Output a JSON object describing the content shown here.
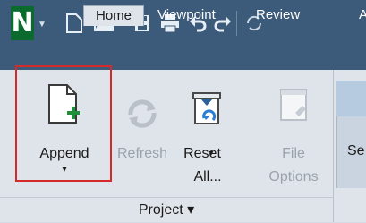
{
  "app": {
    "logo_letter": "N",
    "brand_color": "#0b6b2e",
    "titlebar_color": "#3c5a79"
  },
  "quick_access": {
    "icons": [
      "new-file-icon",
      "open-folder-icon",
      "save-icon",
      "print-icon",
      "undo-icon",
      "redo-icon",
      "refresh-icon"
    ]
  },
  "tabs": [
    {
      "label": "Home",
      "active": true
    },
    {
      "label": "Viewpoint",
      "active": false
    },
    {
      "label": "Review",
      "active": false
    },
    {
      "label": "A",
      "active": false
    }
  ],
  "ribbon": {
    "group_label": "Project ▾",
    "buttons": [
      {
        "label": "Append",
        "dropdown": "▾",
        "enabled": true
      },
      {
        "label": "Refresh",
        "enabled": false
      },
      {
        "label_line1": "Reset",
        "label_line2": "All...",
        "dropdown": "▾",
        "enabled": true
      },
      {
        "label_line1": "File",
        "label_line2": "Options",
        "enabled": false
      }
    ],
    "right_partial_text": "Se"
  },
  "highlight_color": "#d42a2a"
}
